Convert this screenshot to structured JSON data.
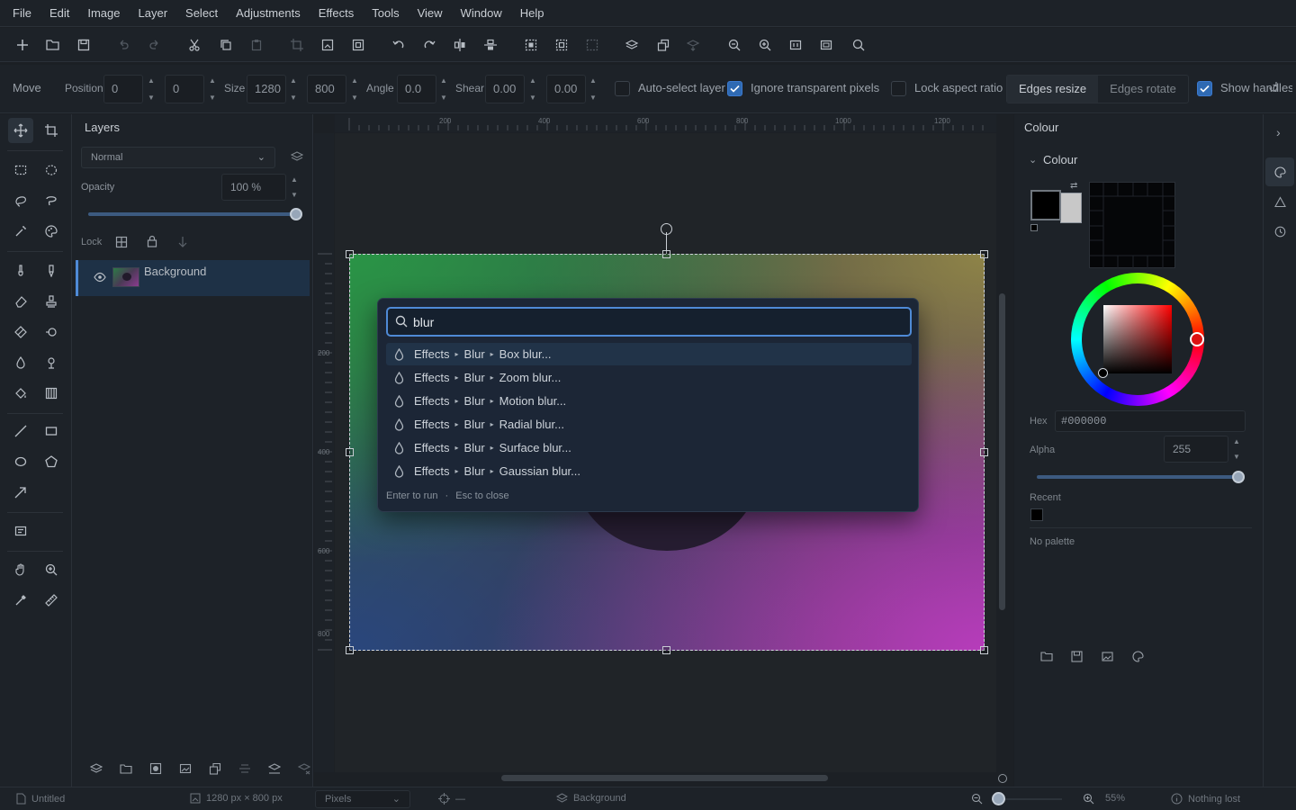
{
  "menu": [
    "File",
    "Edit",
    "Image",
    "Layer",
    "Select",
    "Adjustments",
    "Effects",
    "Tools",
    "View",
    "Window",
    "Help"
  ],
  "options": {
    "tool_name": "Move",
    "position_label": "Position",
    "pos_x": "0",
    "pos_y": "0",
    "size_label": "Size",
    "width": "1280",
    "height": "800",
    "angle_label": "Angle",
    "angle": "0.0",
    "shear_label": "Shear",
    "shear_x": "0.00",
    "shear_y": "0.00",
    "auto_select": {
      "label": "Auto-select layer",
      "checked": false
    },
    "ignore_transparent": {
      "label": "Ignore transparent pixels",
      "checked": true
    },
    "lock_aspect": {
      "label": "Lock aspect ratio",
      "checked": false
    },
    "edges_resize": "Edges resize",
    "edges_rotate": "Edges rotate",
    "show_handles": {
      "label": "Show handles",
      "checked": true
    }
  },
  "layers": {
    "title": "Layers",
    "blend_mode": "Normal",
    "opacity_label": "Opacity",
    "opacity_value": "100 %",
    "opacity_fraction": 1.0,
    "lock_label": "Lock",
    "items": [
      {
        "name": "Background",
        "visible": true,
        "selected": true
      }
    ]
  },
  "canvas": {
    "ruler_top": [
      "200",
      "400",
      "600",
      "800",
      "1000",
      "1200"
    ],
    "ruler_left": [
      "200",
      "400",
      "600",
      "800"
    ]
  },
  "palette": {
    "query": "blur",
    "results": [
      {
        "path": [
          "Effects",
          "Blur",
          "Box blur..."
        ],
        "selected": true
      },
      {
        "path": [
          "Effects",
          "Blur",
          "Zoom blur..."
        ],
        "selected": false
      },
      {
        "path": [
          "Effects",
          "Blur",
          "Motion blur..."
        ],
        "selected": false
      },
      {
        "path": [
          "Effects",
          "Blur",
          "Radial blur..."
        ],
        "selected": false
      },
      {
        "path": [
          "Effects",
          "Blur",
          "Surface blur..."
        ],
        "selected": false
      },
      {
        "path": [
          "Effects",
          "Blur",
          "Gaussian blur..."
        ],
        "selected": false
      }
    ],
    "hint_run": "Enter to run",
    "hint_sep": "·",
    "hint_close": "Esc to close"
  },
  "colour": {
    "panel_title": "Colour",
    "section_title": "Colour",
    "primary_color": "#000000",
    "secondary_color": "#c8c8c8",
    "hex_label": "Hex",
    "hex_value": "#000000",
    "alpha_label": "Alpha",
    "alpha_value": "255",
    "alpha_fraction": 1.0,
    "recent_label": "Recent",
    "recent_colors": [
      "#000000"
    ],
    "palette_text": "No palette"
  },
  "status": {
    "document": "Untitled",
    "dimensions": "1280 px × 800 px",
    "units": "Pixels",
    "cursor": "—",
    "layer": "Background",
    "zoom": "55%",
    "history": "Nothing lost"
  },
  "colors": {
    "accent": "#4f8ad6",
    "selected_row": "#213348",
    "panel_bg": "#1d2228"
  }
}
